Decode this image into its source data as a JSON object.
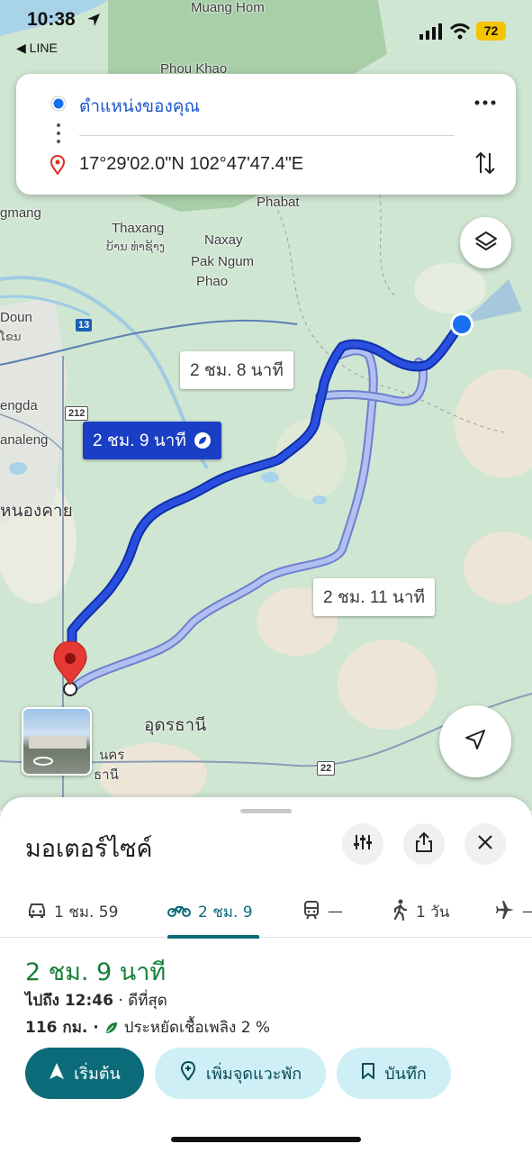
{
  "status_bar": {
    "time": "10:38",
    "back_app": "◀ LINE",
    "battery": "72"
  },
  "directions": {
    "origin": "ตำแหน่งของคุณ",
    "destination": "17°29'02.0\"N 102°47'47.4\"E"
  },
  "map": {
    "labels": {
      "muang_hom": "Muang Hom",
      "phou_khao": "Phou Khao",
      "phabat": "Phabat",
      "thaxang": "Thaxang",
      "thaxang_lao": "ບ້ານ ທ່າຊ້າງ",
      "naxay": "Naxay",
      "pak_ngum": "Pak Ngum",
      "phao": "Phao",
      "gmang": "gmang",
      "doun": "Doun",
      "doun_lao": "ໂຂນ",
      "engda": "engda",
      "analeng": "analeng",
      "nong_khai": "หนองคาย",
      "udon_thani": "อุดรธานี",
      "udon_partial": "นคร",
      "udon_partial2": "ธานี"
    },
    "shields": {
      "r13": "13",
      "r212": "212",
      "r22": "22"
    },
    "route_times": {
      "selected": "2 ชม. 9 นาที",
      "alt1": "2 ชม. 8 นาที",
      "alt2": "2 ชม. 11 นาที"
    }
  },
  "sheet": {
    "title": "มอเตอร์ไซค์",
    "modes": [
      {
        "label": "1 ชม. 59",
        "icon": "car-icon"
      },
      {
        "label": "2 ชม. 9",
        "icon": "motorcycle-icon"
      },
      {
        "label": "—",
        "icon": "train-icon"
      },
      {
        "label": "1 วัน",
        "icon": "walk-icon"
      },
      {
        "label": "—",
        "icon": "plane-icon"
      }
    ],
    "duration": "2 ชม. 9 นาที",
    "arrive_label": "ไปถึง 12:46",
    "arrive_note": " · ดีที่สุด",
    "distance": "116 กม. ·",
    "fuel_note": "ประหยัดเชื้อเพลิง 2 %",
    "buttons": {
      "start": "เริ่มต้น",
      "add_stop": "เพิ่มจุดแวะพัก",
      "save": "บันทึก"
    }
  },
  "colors": {
    "accent": "#0b6b78",
    "route_selected": "#1a3fc4",
    "route_alt": "#9fb1ea",
    "duration_green": "#188038"
  }
}
